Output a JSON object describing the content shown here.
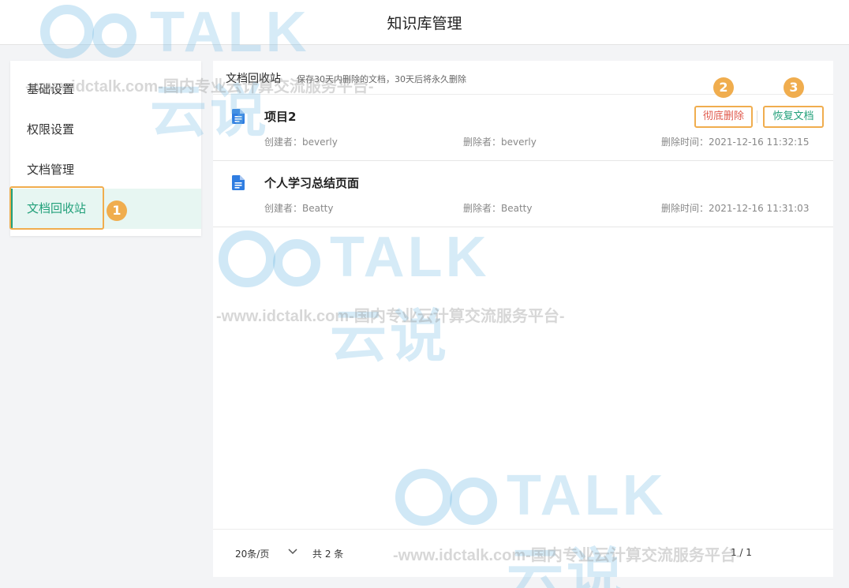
{
  "header": {
    "title": "知识库管理"
  },
  "sidebar": {
    "items": [
      {
        "label": "基础设置"
      },
      {
        "label": "权限设置"
      },
      {
        "label": "文档管理"
      },
      {
        "label": "文档回收站"
      }
    ],
    "active_index": 3
  },
  "panel": {
    "title": "文档回收站",
    "subtitle": "保存30天内删除的文档，30天后将永久删除"
  },
  "documents": [
    {
      "name": "项目2",
      "creator": "创建者：beverly",
      "deleter": "删除者：beverly",
      "deleted_time": "删除时间：2021-12-16 11:32:15"
    },
    {
      "name": "个人学习总结页面",
      "creator": "创建者：Beatty",
      "deleter": "删除者：Beatty",
      "deleted_time": "删除时间：2021-12-16 11:31:03"
    }
  ],
  "actions": {
    "delete_permanently": "彻底删除",
    "restore": "恢复文档"
  },
  "annotations": [
    "1",
    "2",
    "3"
  ],
  "pagination": {
    "page_size": "20条/页",
    "total": "共 2 条",
    "page": "1 / 1"
  },
  "watermark": {
    "logo": "TALK 云说",
    "url": "-www.idctalk.com-国内专业云计算交流服务平台-"
  },
  "colors": {
    "accent": "#22a07a",
    "danger": "#e05a4d",
    "highlight": "#f0ad4e",
    "doc_icon": "#2f7de1"
  }
}
